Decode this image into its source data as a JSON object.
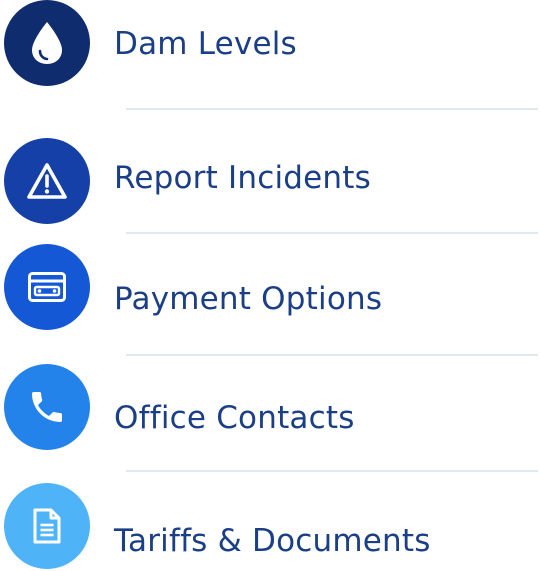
{
  "menu": {
    "items": [
      {
        "label": "Dam Levels",
        "icon": "water-drop-icon",
        "color": "#0f2d6e"
      },
      {
        "label": "Report Incidents",
        "icon": "warning-triangle-icon",
        "color": "#1540a8"
      },
      {
        "label": "Payment Options",
        "icon": "payment-card-icon",
        "color": "#1558d6"
      },
      {
        "label": "Office Contacts",
        "icon": "phone-icon",
        "color": "#2483ea"
      },
      {
        "label": "Tariffs & Documents",
        "icon": "document-icon",
        "color": "#4fb4f7"
      }
    ]
  },
  "theme": {
    "label_color": "#1b3f86",
    "divider_color": "#dfeaf5"
  }
}
